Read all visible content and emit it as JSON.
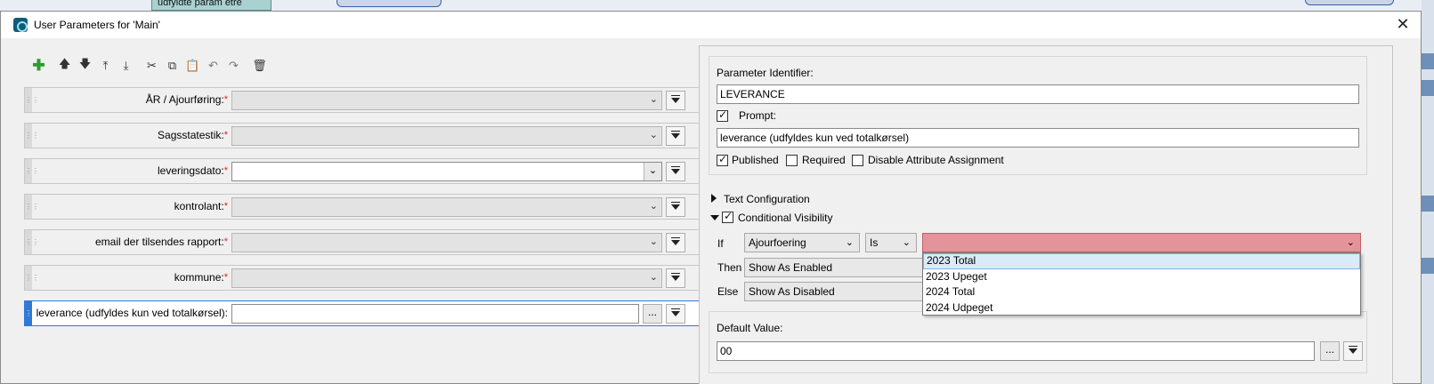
{
  "background": {
    "node_label": "udfyldte param etre"
  },
  "window": {
    "title": "User Parameters for 'Main'",
    "close_glyph": "✕"
  },
  "toolbar": {
    "buttons": [
      {
        "name": "add-parameter-icon",
        "glyph": "✚"
      },
      {
        "name": "move-up-icon",
        "glyph": "🡅"
      },
      {
        "name": "move-down-icon",
        "glyph": "🡇"
      },
      {
        "name": "move-to-top-icon",
        "glyph": "⤒"
      },
      {
        "name": "move-to-bottom-icon",
        "glyph": "⤓"
      },
      {
        "name": "cut-icon",
        "glyph": "✂"
      },
      {
        "name": "copy-icon",
        "glyph": "⧉"
      },
      {
        "name": "paste-icon",
        "glyph": "📋"
      },
      {
        "name": "undo-icon",
        "glyph": "↶"
      },
      {
        "name": "redo-icon",
        "glyph": "↷"
      },
      {
        "name": "delete-icon",
        "glyph": "🗑"
      }
    ]
  },
  "parameters": [
    {
      "label": "ÅR / Ajourføring:",
      "required": true,
      "type": "combo-disabled"
    },
    {
      "label": "Sagsstatestik:",
      "required": true,
      "type": "combo-disabled"
    },
    {
      "label": "leveringsdato:",
      "required": true,
      "type": "combo-white"
    },
    {
      "label": "kontrolant:",
      "required": true,
      "type": "combo-disabled"
    },
    {
      "label": "email der tilsendes rapport:",
      "required": true,
      "type": "combo-disabled"
    },
    {
      "label": "kommune:",
      "required": true,
      "type": "combo-disabled"
    },
    {
      "label": "leverance (udfyldes kun ved totalkørsel):",
      "required": false,
      "type": "text-active"
    }
  ],
  "required_mark": "*",
  "ellipsis": "...",
  "chevron": "⌄",
  "editor": {
    "identifier_label": "Parameter Identifier:",
    "identifier_value": "LEVERANCE",
    "prompt_label": "Prompt:",
    "prompt_checked": true,
    "prompt_value": "leverance (udfyldes kun ved totalkørsel)",
    "published_label": "Published",
    "published_checked": true,
    "required_label": "Required",
    "required_checked": false,
    "disable_attr_label": "Disable Attribute Assignment",
    "disable_attr_checked": false,
    "text_config_label": "Text Configuration",
    "cond_vis_label": "Conditional Visibility",
    "cond_vis_checked": true,
    "if_label": "If",
    "if_attr": "Ajourfoering",
    "if_op": "Is",
    "if_value": "",
    "then_label": "Then",
    "then_value": "Show As Enabled",
    "else_label": "Else",
    "else_value": "Show As Disabled",
    "dropdown_options": [
      "2023 Total",
      "2023 Upeget",
      "2024 Total",
      "2024 Udpeget"
    ],
    "dropdown_highlighted": "2023 Total",
    "default_label": "Default Value:",
    "default_value": "00"
  },
  "colors": {
    "error_field": "#e3939a",
    "active_border": "#2f7ad7",
    "highlight": "#d9ebf9"
  }
}
